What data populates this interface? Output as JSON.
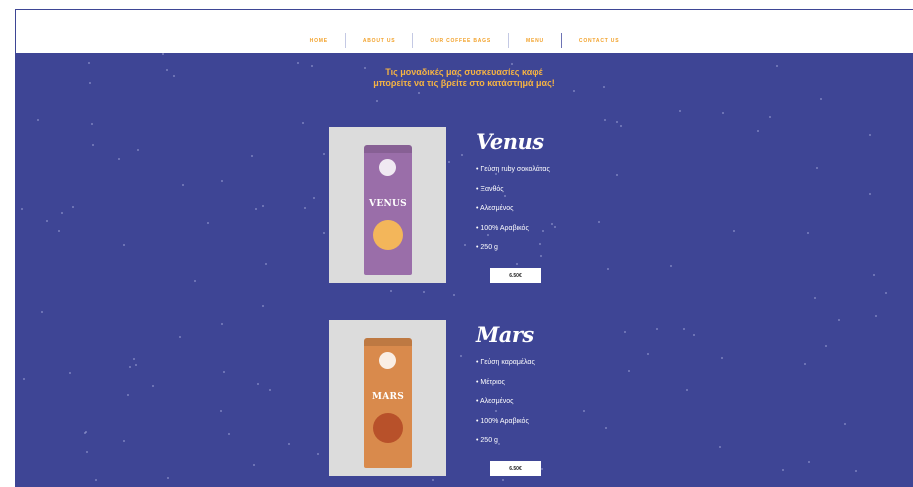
{
  "nav": {
    "items": [
      "HOME",
      "ABOUT US",
      "OUR COFFEE BAGS",
      "MENU",
      "CONTACT US"
    ]
  },
  "intro": {
    "line1": "Τις μοναδικές μας συσκευασίες καφέ",
    "line2": "μπορείτε να τις βρείτε στο κατάστημά μας!"
  },
  "products": [
    {
      "name": "Venus",
      "bag_label": "VENUS",
      "bag_color": "#9a6ea9",
      "planet_color": "#f3b65a",
      "features": [
        "Γεύση ruby σοκολάτας",
        "Ξανθός",
        "Αλεσμένος",
        "100% Αραβικός",
        "250 g"
      ],
      "price": "6.50€"
    },
    {
      "name": "Mars",
      "bag_label": "MARS",
      "bag_color": "#d98a4c",
      "planet_color": "#b8512a",
      "features": [
        "Γεύση καραμέλας",
        "Μέτριος",
        "Αλεσμένος",
        "100% Αραβικός",
        "250 g"
      ],
      "price": "6.50€"
    }
  ],
  "colors": {
    "background": "#3e4595",
    "accent": "#f2a22b",
    "intro_text": "#f5b343"
  }
}
